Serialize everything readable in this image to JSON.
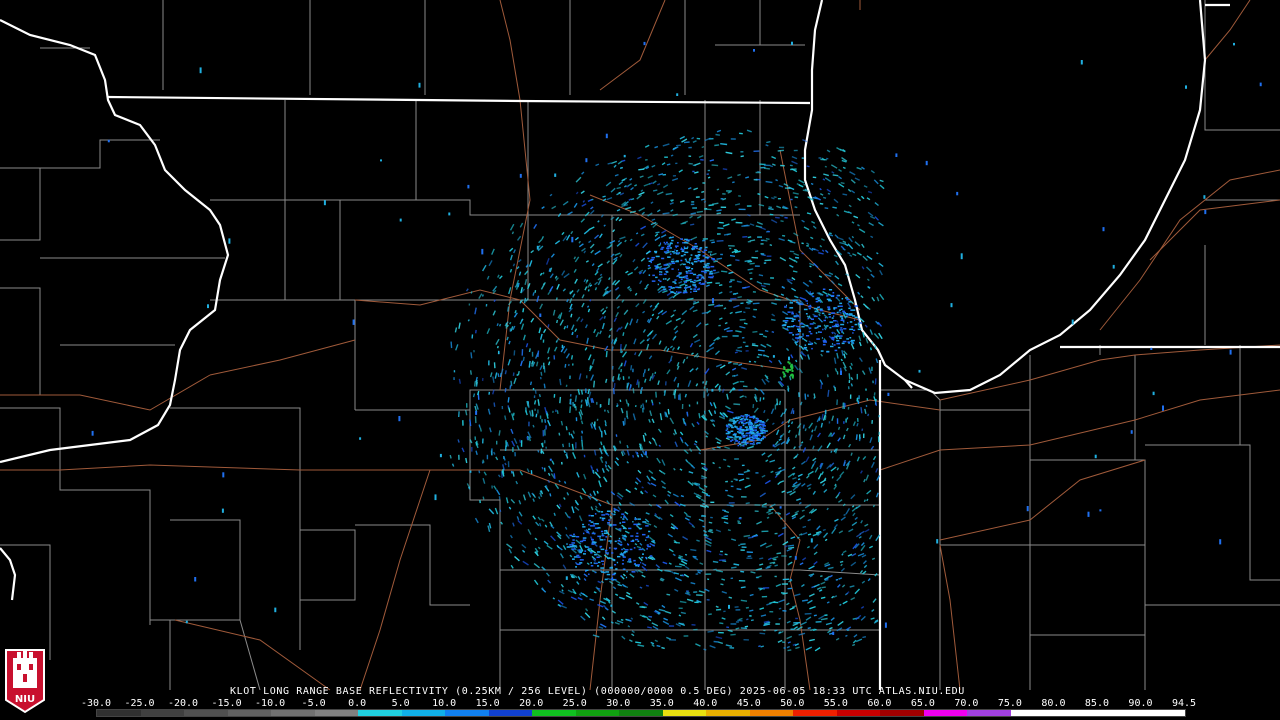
{
  "radar": {
    "caption": "KLOT LONG RANGE BASE REFLECTIVITY (0.25KM / 256 LEVEL) (000000/0000 0.5 DEG) 2025-06-05 18:33 UTC  ATLAS.NIU.EDU",
    "site": "KLOT",
    "product": "LONG RANGE BASE REFLECTIVITY",
    "timestamp": "2025-06-05 18:33 UTC",
    "source": "ATLAS.NIU.EDU"
  },
  "color_scale": {
    "labels": [
      "-30.0",
      "-25.0",
      "-20.0",
      "-15.0",
      "-10.0",
      "-5.0",
      "0.0",
      "5.0",
      "10.0",
      "15.0",
      "20.0",
      "25.0",
      "30.0",
      "35.0",
      "40.0",
      "45.0",
      "50.0",
      "55.0",
      "60.0",
      "65.0",
      "70.0",
      "75.0",
      "80.0",
      "85.0",
      "90.0",
      "94.5"
    ],
    "colors": [
      "#303030",
      "#404040",
      "#505050",
      "#606060",
      "#707070",
      "#808080",
      "#20d0e0",
      "#10b0e8",
      "#1080f0",
      "#1040d0",
      "#10c020",
      "#10a010",
      "#108010",
      "#e8e010",
      "#e8b000",
      "#f08000",
      "#f02000",
      "#c80000",
      "#a00000",
      "#f000f0",
      "#a040e0",
      "#ffffff",
      "#ffffff",
      "#ffffff",
      "#ffffff"
    ]
  },
  "logo": {
    "text": "NIU",
    "color": "#c8102e"
  }
}
